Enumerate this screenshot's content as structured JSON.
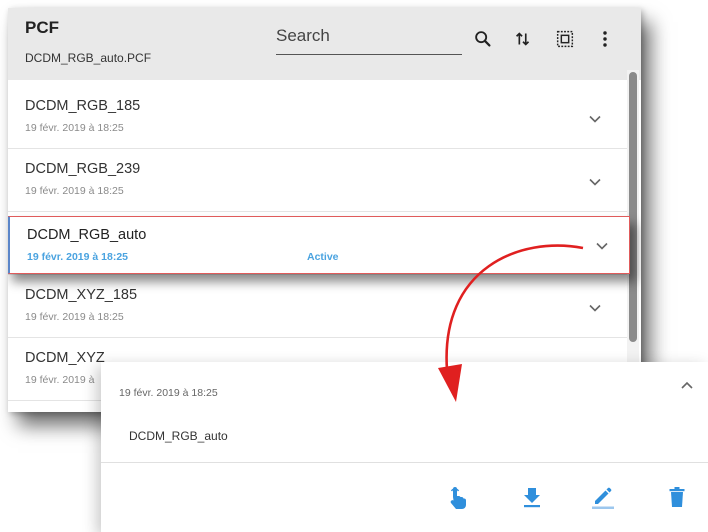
{
  "header": {
    "title": "PCF",
    "subtitle": "DCDM_RGB_auto.PCF",
    "search_placeholder": "Search"
  },
  "icons": {
    "search": "search-icon",
    "sort": "sort-icon",
    "select_all": "select-all-icon",
    "more": "more-vert-icon"
  },
  "items": [
    {
      "name": "DCDM_RGB_185",
      "date": "19 févr. 2019 à 18:25"
    },
    {
      "name": "DCDM_RGB_239",
      "date": "19 févr. 2019 à 18:25"
    },
    {
      "name": "DCDM_RGB_auto",
      "date": "19 févr. 2019 à 18:25",
      "status": "Active"
    },
    {
      "name": "DCDM_XYZ_185",
      "date": "19 févr. 2019 à 18:25"
    },
    {
      "name": "DCDM_XYZ",
      "date": "19 févr. 2019 à"
    }
  ],
  "detail": {
    "date": "19 févr. 2019 à 18:25",
    "name": "DCDM_RGB_auto",
    "actions": [
      "activate-icon",
      "download-icon",
      "edit-icon",
      "delete-icon"
    ]
  },
  "colors": {
    "accent": "#2f8fdc",
    "active_text": "#4aa3e0",
    "active_border": "#e05b5b",
    "arrow": "#e02020",
    "header_bg": "#e9e9e9"
  }
}
